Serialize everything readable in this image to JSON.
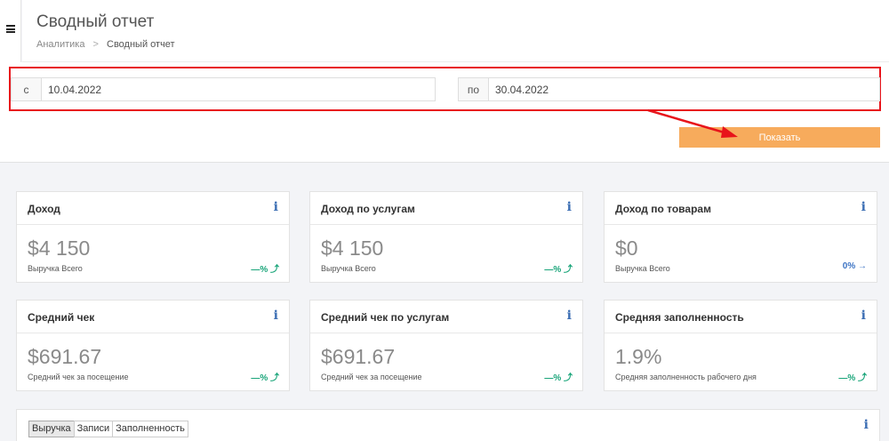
{
  "header": {
    "title": "Сводный отчет",
    "breadcrumb": {
      "parent": "Аналитика",
      "separator": ">",
      "current": "Сводный отчет"
    }
  },
  "filter": {
    "from_label": "с",
    "from_value": "10.04.2022",
    "to_label": "по",
    "to_value": "30.04.2022",
    "submit_label": "Показать"
  },
  "cards": [
    {
      "title": "Доход",
      "value": "$4 150",
      "sub": "Выручка Всего",
      "trend": "—% ⤴"
    },
    {
      "title": "Доход по услугам",
      "value": "$4 150",
      "sub": "Выручка Всего",
      "trend": "—% ⤴"
    },
    {
      "title": "Доход по товарам",
      "value": "$0",
      "sub": "Выручка Всего",
      "trend": "0% →"
    },
    {
      "title": "Средний чек",
      "value": "$691.67",
      "sub": "Средний чек за посещение",
      "trend": "—% ⤴"
    },
    {
      "title": "Средний чек по услугам",
      "value": "$691.67",
      "sub": "Средний чек за посещение",
      "trend": "—% ⤴"
    },
    {
      "title": "Средняя заполненность",
      "value": "1.9%",
      "sub": "Средняя заполненность рабочего дня",
      "trend": "—% ⤴"
    }
  ],
  "info_glyph": "i",
  "tabs": [
    "Выручка",
    "Записи",
    "Заполненность"
  ],
  "colors": {
    "accent_button": "#f7ab5c",
    "highlight": "#e8141b",
    "trend_up": "#1aa57a",
    "trend_flat": "#3d74c4",
    "info": "#3d6fb4"
  },
  "icons": {
    "menu": "hamburger-menu-icon",
    "info": "info-icon",
    "trend_up": "trend-up-icon",
    "trend_flat": "arrow-right-icon"
  }
}
